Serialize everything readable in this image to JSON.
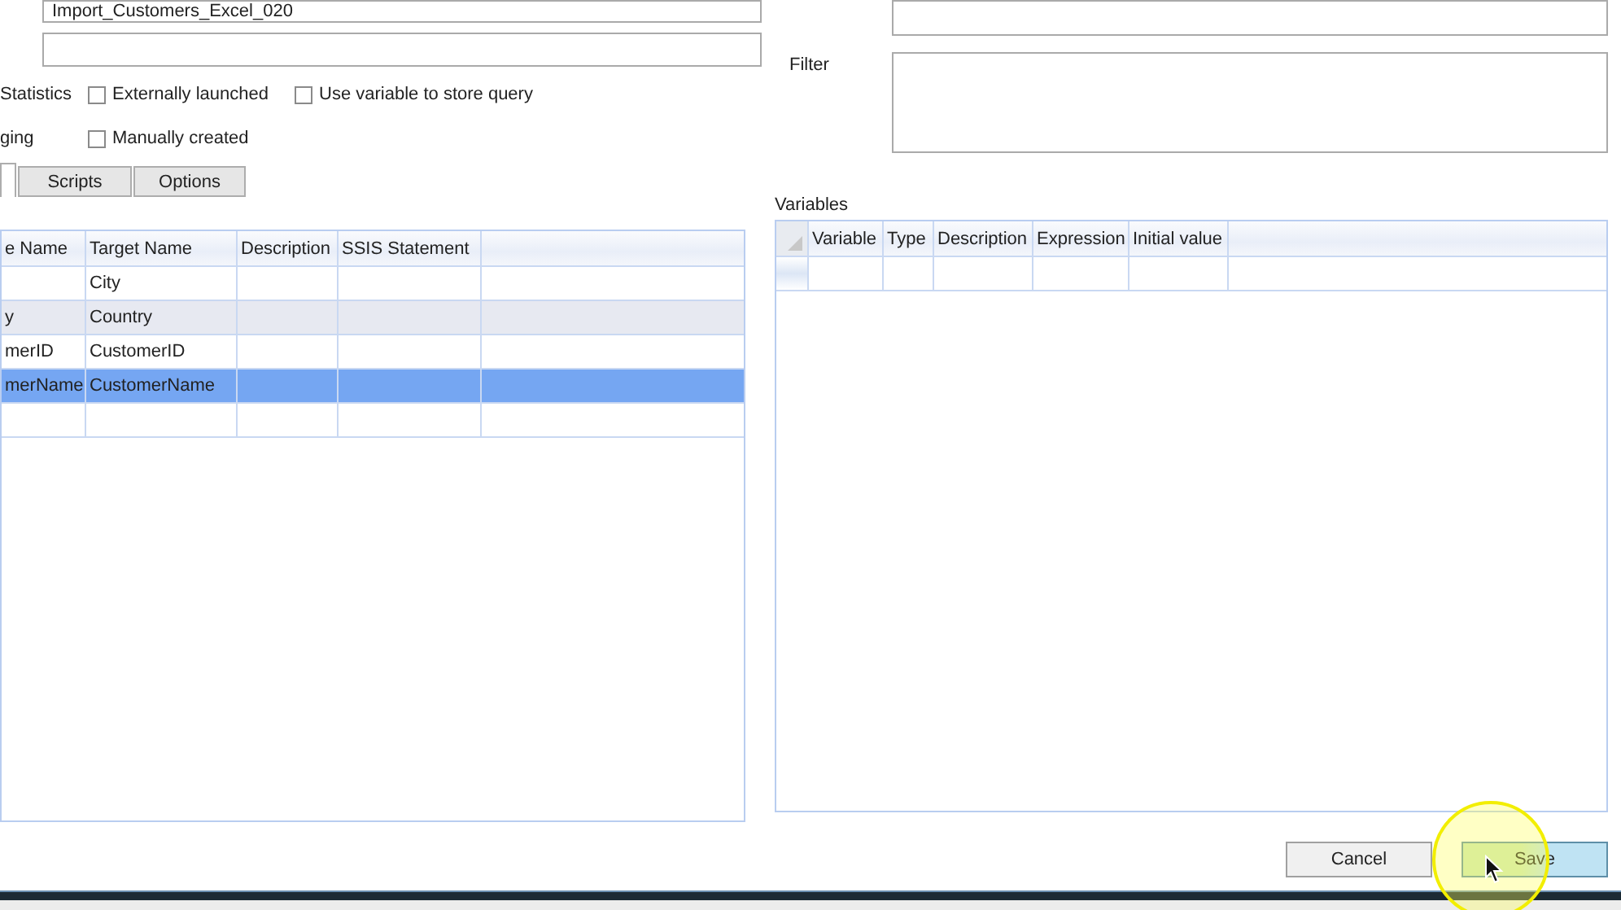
{
  "name_field": {
    "value": "Import_Customers_Excel_020"
  },
  "option_rows": [
    {
      "label": "Statistics",
      "checks": [
        {
          "label": "Externally launched",
          "checked": false
        },
        {
          "label": "Use variable to store query",
          "checked": false
        }
      ]
    },
    {
      "label": "ging",
      "checks": [
        {
          "label": "Manually created",
          "checked": false
        }
      ]
    }
  ],
  "tabs": [
    {
      "selected": true
    },
    {
      "label": "Scripts",
      "selected": false
    },
    {
      "label": "Options",
      "selected": false
    }
  ],
  "columns_grid": {
    "columns": [
      "e Name",
      "Target Name",
      "Description",
      "SSIS Statement"
    ],
    "rows": [
      {
        "cells": [
          "",
          "City"
        ],
        "selected": false
      },
      {
        "cells": [
          "y",
          "Country"
        ],
        "selected": false
      },
      {
        "cells": [
          "merID",
          "CustomerID"
        ],
        "selected": false
      },
      {
        "cells": [
          "merName",
          "CustomerName"
        ],
        "selected": true
      }
    ]
  },
  "filter": {
    "label": "Filter"
  },
  "variables": {
    "label": "Variables",
    "columns": [
      "Variable",
      "Type",
      "Description",
      "Expression",
      "Initial value"
    ]
  },
  "buttons": [
    {
      "label": "Cancel",
      "kind": "plain"
    },
    {
      "label": "Save",
      "kind": "primary"
    }
  ]
}
